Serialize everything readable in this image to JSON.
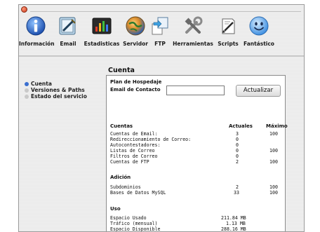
{
  "toolbar": {
    "items": [
      {
        "label": "Información",
        "icon": "info-icon"
      },
      {
        "label": "Email",
        "icon": "email-icon"
      },
      {
        "label": "Estadisticas",
        "icon": "stats-icon"
      },
      {
        "label": "Servidor",
        "icon": "globe-icon"
      },
      {
        "label": "FTP",
        "icon": "ftp-icon"
      },
      {
        "label": "Herramientas",
        "icon": "tools-icon"
      },
      {
        "label": "Scripts",
        "icon": "scripts-icon"
      },
      {
        "label": "Fantástico",
        "icon": "smiley-icon"
      }
    ]
  },
  "sidebar": {
    "items": [
      {
        "label": "Cuenta",
        "selected": true
      },
      {
        "label": "Versiones & Paths",
        "selected": false
      },
      {
        "label": "Estado del servicio",
        "selected": false
      }
    ]
  },
  "main": {
    "title": "Cuenta",
    "plan_label": "Plan de Hospedaje",
    "email_label": "Email de Contacto",
    "email_value": "",
    "update_button": "Actualizar",
    "cuentas": {
      "heading": "Cuentas",
      "col_actuales": "Actuales",
      "col_maximo": "Máximo",
      "rows": [
        {
          "name": "Cuentas de Email:",
          "actual": "3",
          "max": "100"
        },
        {
          "name": "Redireccionamiento de Correo:",
          "actual": "0",
          "max": ""
        },
        {
          "name": "Autocontestadores:",
          "actual": "0",
          "max": ""
        },
        {
          "name": "Listas de Correo",
          "actual": "0",
          "max": "100"
        },
        {
          "name": "Filtros de Correo",
          "actual": "0",
          "max": ""
        },
        {
          "name": "Cuentas de FTP",
          "actual": "2",
          "max": "100"
        }
      ]
    },
    "adicion": {
      "heading": "Adición",
      "rows": [
        {
          "name": "Subdominios",
          "actual": "2",
          "max": "100"
        },
        {
          "name": "Bases de Datos MySQL",
          "actual": "33",
          "max": "100"
        }
      ]
    },
    "uso": {
      "heading": "Uso",
      "rows": [
        {
          "name": "Espacio Usado",
          "value": "211.84 MB"
        },
        {
          "name": "Tráfico (mensual)",
          "value": "1.13 MB"
        },
        {
          "name": "Espacio Disponible",
          "value": "288.16 MB"
        }
      ]
    }
  },
  "colors": {
    "selected_dot": "#3a6fd0",
    "unselected_dot": "#c9c9c9"
  }
}
